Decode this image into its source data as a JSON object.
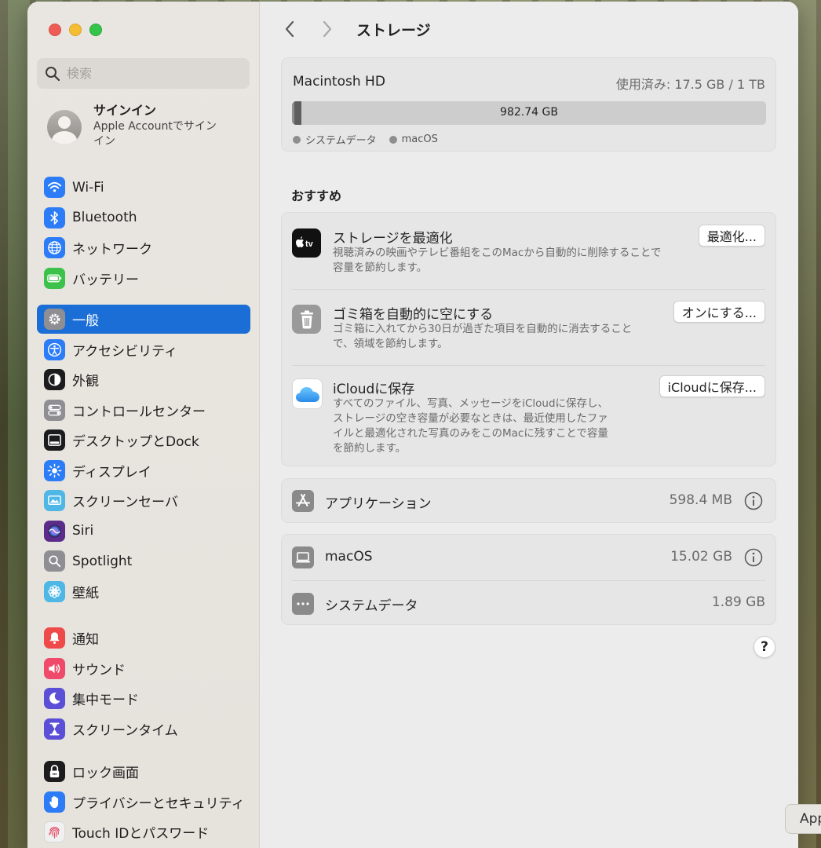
{
  "window": {
    "title": "ストレージ",
    "colors": {
      "accent": "#1b6ed6"
    }
  },
  "search": {
    "placeholder": "検索"
  },
  "account": {
    "title": "サインイン",
    "subtitle": "Apple Accountでサインイン"
  },
  "sidebar": {
    "groups": [
      [
        {
          "label": "Wi-Fi",
          "icon": "wifi-icon",
          "color": "#2b7cf6",
          "active": false
        },
        {
          "label": "Bluetooth",
          "icon": "bluetooth-icon",
          "color": "#2b7cf6",
          "active": false
        },
        {
          "label": "ネットワーク",
          "icon": "globe-icon",
          "color": "#2b7cf6",
          "active": false
        },
        {
          "label": "バッテリー",
          "icon": "battery-icon",
          "color": "#3cc24a",
          "active": false
        }
      ],
      [
        {
          "label": "一般",
          "icon": "gear-icon",
          "color": "#8e8e93",
          "active": true
        },
        {
          "label": "アクセシビリティ",
          "icon": "accessibility-icon",
          "color": "#2b7cf6",
          "active": false
        },
        {
          "label": "外観",
          "icon": "appearance-icon",
          "color": "#1c1c1e",
          "active": false
        },
        {
          "label": "コントロールセンター",
          "icon": "control-center-icon",
          "color": "#8e8e93",
          "active": false
        },
        {
          "label": "デスクトップとDock",
          "icon": "dock-icon",
          "color": "#1c1c1e",
          "active": false
        },
        {
          "label": "ディスプレイ",
          "icon": "display-icon",
          "color": "#2b7cf6",
          "active": false
        },
        {
          "label": "スクリーンセーバ",
          "icon": "screensaver-icon",
          "color": "#4fb7e6",
          "active": false
        },
        {
          "label": "Siri",
          "icon": "siri-icon",
          "color": "#5b2c8a",
          "active": false
        },
        {
          "label": "Spotlight",
          "icon": "spotlight-icon",
          "color": "#8e8e93",
          "active": false
        },
        {
          "label": "壁紙",
          "icon": "wallpaper-icon",
          "color": "#4fb7e6",
          "active": false
        }
      ],
      [
        {
          "label": "通知",
          "icon": "notification-icon",
          "color": "#ef4a4a",
          "active": false
        },
        {
          "label": "サウンド",
          "icon": "sound-icon",
          "color": "#ef4a6a",
          "active": false
        },
        {
          "label": "集中モード",
          "icon": "focus-moon-icon",
          "color": "#5a4fd6",
          "active": false
        },
        {
          "label": "スクリーンタイム",
          "icon": "hourglass-icon",
          "color": "#5a4fd6",
          "active": false
        }
      ],
      [
        {
          "label": "ロック画面",
          "icon": "lock-icon",
          "color": "#1c1c1e",
          "active": false
        },
        {
          "label": "プライバシーとセキュリティ",
          "icon": "hand-icon",
          "color": "#2b7cf6",
          "active": false
        },
        {
          "label": "Touch IDとパスワード",
          "icon": "fingerprint-icon",
          "color": "#f0f0f0",
          "active": false
        }
      ]
    ]
  },
  "disk": {
    "name": "Macintosh HD",
    "usage": "使用済み: 17.5 GB / 1 TB",
    "available_label": "982.74 GB",
    "system_fraction": 0.0019,
    "macos_fraction": 0.015,
    "legend": [
      {
        "label": "システムデータ",
        "color": "#8e8e8e"
      },
      {
        "label": "macOS",
        "color": "#8e8e8e"
      }
    ]
  },
  "recommendations": {
    "title": "おすすめ",
    "items": [
      {
        "title": "ストレージを最適化",
        "desc1": "視聴済みの映画やテレビ番組をこのMacから自動的に削除することで",
        "desc2": "容量を節約します。",
        "desc3": "",
        "desc4": "",
        "button": "最適化...",
        "icon": "apple-tv-icon"
      },
      {
        "title": "ゴミ箱を自動的に空にする",
        "desc1": "ゴミ箱に入れてから30日が過ぎた項目を自動的に消去すること",
        "desc2": "で、領域を節約します。",
        "desc3": "",
        "desc4": "",
        "button": "オンにする...",
        "icon": "trash-icon"
      },
      {
        "title": "iCloudに保存",
        "desc1": "すべてのファイル、写真、メッセージをiCloudに保存し、",
        "desc2": "ストレージの空き容量が必要なときは、最近使用したファ",
        "desc3": "イルと最適化された写真のみをこのMacに残すことで容量",
        "desc4": "を節約します。",
        "button": "iCloudに保存...",
        "icon": "icloud-icon"
      }
    ]
  },
  "categories": [
    {
      "label": "アプリケーション",
      "size": "598.4 MB",
      "icon": "app-store-icon"
    },
    {
      "label": "macOS",
      "size": "15.02 GB",
      "icon": "laptop-icon"
    },
    {
      "label": "システムデータ",
      "size": "1.89 GB",
      "icon": "ellipsis-icon"
    }
  ],
  "help": {
    "label": "?"
  },
  "dock_tab": {
    "label": "App"
  }
}
